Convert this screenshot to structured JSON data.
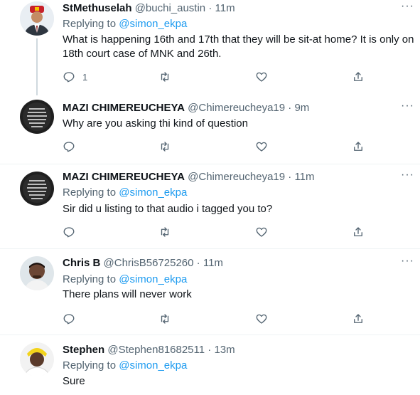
{
  "tweets": [
    {
      "name": "StMethuselah",
      "handle": "@buchi_austin",
      "time": "11m",
      "replying_label": "Replying to",
      "replying_to": "@simon_ekpa",
      "text": "What is happening 16th and 17th that they will be sit-at home? It is only on 18th court case of MNK and 26th.",
      "reply_count": "1"
    },
    {
      "name": "MAZI CHIMEREUCHEYA",
      "handle": "@Chimereucheya19",
      "time": "9m",
      "text": "Why are you asking thi kind of question"
    },
    {
      "name": "MAZI CHIMEREUCHEYA",
      "handle": "@Chimereucheya19",
      "time": "11m",
      "replying_label": "Replying to",
      "replying_to": "@simon_ekpa",
      "text": "Sir did u listing to that audio i tagged you to?"
    },
    {
      "name": "Chris B",
      "handle": "@ChrisB56725260",
      "time": "11m",
      "replying_label": "Replying to",
      "replying_to": "@simon_ekpa",
      "text": "There plans will never work"
    },
    {
      "name": "Stephen",
      "handle": "@Stephen81682511",
      "time": "13m",
      "replying_label": "Replying to",
      "replying_to": "@simon_ekpa",
      "text": "Sure"
    }
  ],
  "separator": "·",
  "more_glyph": "···",
  "icons": [
    "reply-icon",
    "retweet-icon",
    "like-icon",
    "share-icon",
    "more-icon"
  ],
  "colors": {
    "text": "#0f1419",
    "secondary": "#536471",
    "link": "#1d9bf0",
    "divider": "#eff3f4"
  }
}
